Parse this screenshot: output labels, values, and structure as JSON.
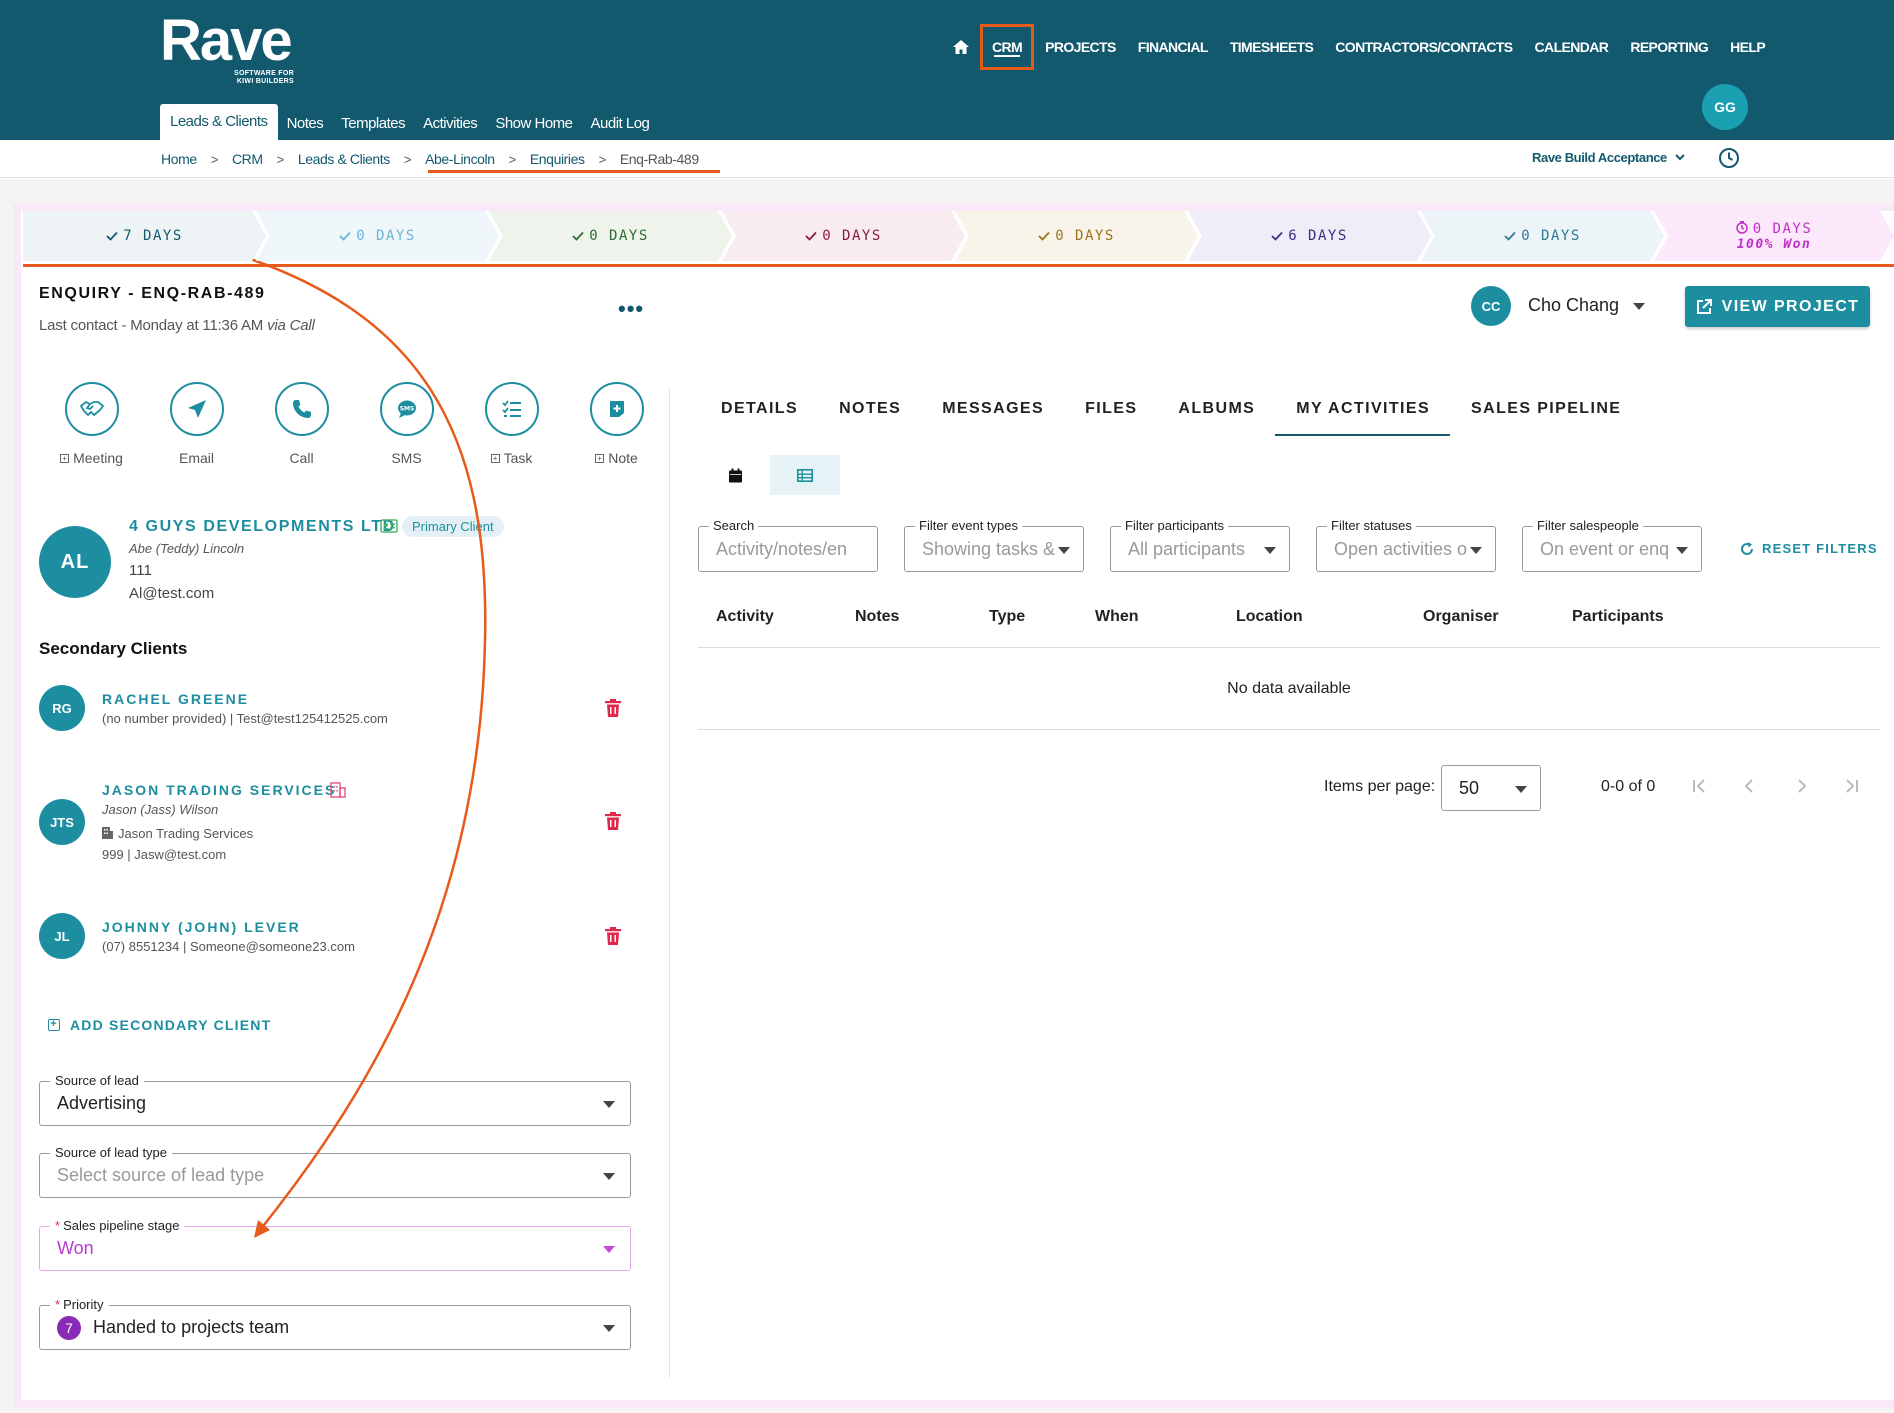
{
  "header": {
    "logo_text": "Rave",
    "logo_tagline": "SOFTWARE FOR KIWI BUILDERS",
    "nav": [
      "CRM",
      "PROJECTS",
      "FINANCIAL",
      "TIMESHEETS",
      "CONTRACTORS/CONTACTS",
      "CALENDAR",
      "REPORTING",
      "HELP"
    ],
    "user_initials": "GG",
    "subnav": [
      "Leads & Clients",
      "Notes",
      "Templates",
      "Activities",
      "Show Home",
      "Audit Log"
    ]
  },
  "breadcrumb": [
    "Home",
    "CRM",
    "Leads & Clients",
    "Abe-Lincoln",
    "Enquiries",
    "Enq-Rab-489"
  ],
  "tenant": "Rave Build Acceptance",
  "stages": [
    {
      "label": "7 DAYS",
      "bg": "#eef3f5",
      "fg": "#12596e"
    },
    {
      "label": "0 DAYS",
      "bg": "#f0f7fb",
      "fg": "#6ab4d6"
    },
    {
      "label": "0 DAYS",
      "bg": "#eef3ec",
      "fg": "#2f6b2f"
    },
    {
      "label": "0 DAYS",
      "bg": "#f8ecf1",
      "fg": "#8a1c3c"
    },
    {
      "label": "0 DAYS",
      "bg": "#f8f4ea",
      "fg": "#9a7320"
    },
    {
      "label": "6 DAYS",
      "bg": "#efedf8",
      "fg": "#3c2f86"
    },
    {
      "label": "0 DAYS",
      "bg": "#edf4f7",
      "fg": "#2c7a94"
    },
    {
      "label": "0 DAYS",
      "sub": "100% Won",
      "bg": "#fbe9fb",
      "fg": "#c030c8"
    }
  ],
  "enquiry": {
    "title": "ENQUIRY - ENQ-RAB-489",
    "last_contact": "Last contact - Monday at 11:36 AM",
    "via": "via Call"
  },
  "actions": [
    {
      "label": "Meeting",
      "plus": true
    },
    {
      "label": "Email",
      "plus": false
    },
    {
      "label": "Call",
      "plus": false
    },
    {
      "label": "SMS",
      "plus": false
    },
    {
      "label": "Task",
      "plus": true
    },
    {
      "label": "Note",
      "plus": true
    }
  ],
  "primary": {
    "initials": "AL",
    "company": "4 GUYS DEVELOPMENTS LTD",
    "badge": "Primary Client",
    "contact": "Abe (Teddy) Lincoln",
    "number": "111",
    "email": "Al@test.com"
  },
  "secondary_title": "Secondary Clients",
  "secondary": [
    {
      "initials": "RG",
      "name": "RACHEL GREENE",
      "line1": "(no number provided)  |  Test@test125412525.com"
    },
    {
      "initials": "JTS",
      "name": "JASON TRADING SERVICES",
      "contact": "Jason (Jass) Wilson",
      "company": "Jason Trading Services",
      "line2": "999  |  Jasw@test.com"
    },
    {
      "initials": "JL",
      "name": "JOHNNY (JOHN) LEVER",
      "line1": "(07) 8551234  |  Someone@someone23.com"
    }
  ],
  "add_secondary": "ADD SECONDARY CLIENT",
  "fields": {
    "source": {
      "label": "Source of lead",
      "value": "Advertising"
    },
    "source_type": {
      "label": "Source of lead type",
      "placeholder": "Select source of lead type"
    },
    "stage": {
      "label": "Sales pipeline stage",
      "value": "Won"
    },
    "priority": {
      "label": "Priority",
      "number": "7",
      "value": "Handed to projects team"
    }
  },
  "owner": {
    "initials": "CC",
    "name": "Cho Chang"
  },
  "view_project": "VIEW PROJECT",
  "tabs": [
    "DETAILS",
    "NOTES",
    "MESSAGES",
    "FILES",
    "ALBUMS",
    "MY ACTIVITIES",
    "SALES PIPELINE"
  ],
  "filters": [
    {
      "label": "Search",
      "placeholder": "Activity/notes/en"
    },
    {
      "label": "Filter event types",
      "placeholder": "Showing tasks &"
    },
    {
      "label": "Filter participants",
      "placeholder": "All participants"
    },
    {
      "label": "Filter statuses",
      "placeholder": "Open activities o"
    },
    {
      "label": "Filter salespeople",
      "placeholder": "On event or enq"
    }
  ],
  "reset_filters": "RESET FILTERS",
  "table": {
    "columns": [
      "Activity",
      "Notes",
      "Type",
      "When",
      "Location",
      "Organiser",
      "Participants"
    ],
    "empty": "No data available"
  },
  "pagination": {
    "label": "Items per page:",
    "per_page": "50",
    "range": "0-0 of 0"
  },
  "colors": {
    "header": "#12596e",
    "accent": "#1d8ea0",
    "annotation": "#e85a1b",
    "won": "#b73bd0"
  }
}
